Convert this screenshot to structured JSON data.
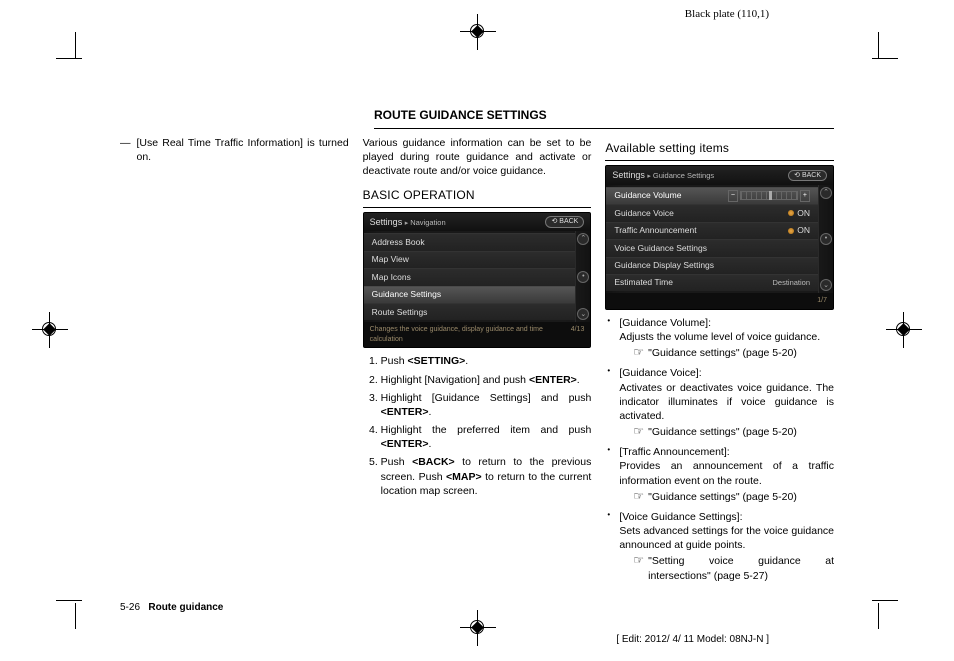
{
  "header_plate": "Black plate (110,1)",
  "col1": {
    "dash_item": "[Use Real Time Traffic Information] is turned on."
  },
  "section_title": "ROUTE GUIDANCE SETTINGS",
  "col2": {
    "intro": "Various guidance information can be set to be played during route guidance and activate or deactivate route and/or voice guidance.",
    "basic_op_title": "BASIC OPERATION",
    "ui": {
      "breadcrumb_a": "Settings",
      "breadcrumb_b": "Navigation",
      "back": "BACK",
      "rows": [
        "Address Book",
        "Map View",
        "Map Icons",
        "Guidance Settings",
        "Route Settings"
      ],
      "footer_left": "Changes the voice guidance, display guidance and time calculation",
      "footer_right": "4/13"
    },
    "steps": {
      "s1a": "Push ",
      "s1b": "<SETTING>",
      "s1c": ".",
      "s2a": "Highlight [Navigation] and push ",
      "s2b": "<ENTER>",
      "s2c": ".",
      "s3a": "Highlight [Guidance Settings] and push ",
      "s3b": "<ENTER>",
      "s3c": ".",
      "s4a": "Highlight the preferred item and push ",
      "s4b": "<ENTER>",
      "s4c": ".",
      "s5a": "Push ",
      "s5b": "<BACK>",
      "s5c": " to return to the previous screen. Push ",
      "s5d": "<MAP>",
      "s5e": " to return to the current location map screen."
    }
  },
  "col3": {
    "avail_title": "Available setting items",
    "ui": {
      "breadcrumb_a": "Settings",
      "breadcrumb_b": "Guidance Settings",
      "back": "BACK",
      "rows": {
        "r0": "Guidance Volume",
        "r1": "Guidance Voice",
        "r1v": "ON",
        "r2": "Traffic Announcement",
        "r2v": "ON",
        "r3": "Voice Guidance Settings",
        "r4": "Guidance Display Settings",
        "r5": "Estimated Time",
        "r5v": "Destination"
      },
      "footer_right": "1/7"
    },
    "items": {
      "i1_label": "[Guidance Volume]:",
      "i1_desc": "Adjusts the volume level of voice guidance.",
      "i1_ref": "\"Guidance settings\" (page 5-20)",
      "i2_label": "[Guidance Voice]:",
      "i2_desc": "Activates or deactivates voice guidance. The indicator illuminates if voice guidance is activated.",
      "i2_ref": "\"Guidance settings\" (page 5-20)",
      "i3_label": "[Traffic Announcement]:",
      "i3_desc": "Provides an announcement of a traffic information event on the route.",
      "i3_ref": "\"Guidance settings\" (page 5-20)",
      "i4_label": "[Voice Guidance Settings]:",
      "i4_desc": "Sets advanced settings for the voice guidance announced at guide points.",
      "i4_ref": "\"Setting voice guidance at intersections\" (page 5-27)"
    }
  },
  "footer": {
    "page_num": "5-26",
    "page_title": "Route guidance",
    "edit": "[ Edit: 2012/ 4/ 11   Model: 08NJ-N ]"
  }
}
